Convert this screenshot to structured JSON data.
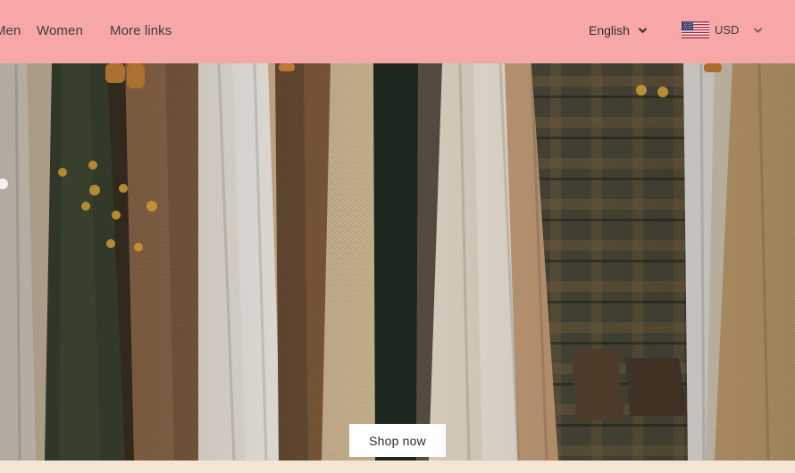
{
  "header": {
    "background": "#f7a7a7",
    "nav": [
      {
        "label": "Men"
      },
      {
        "label": "Women"
      },
      {
        "label": "More links"
      }
    ],
    "language": {
      "selected": "English",
      "icon": "chevron-down-icon"
    },
    "currency": {
      "selected": "USD",
      "flag": "us-flag-icon",
      "icon": "chevron-down-icon"
    }
  },
  "hero": {
    "image": "hanging-clothes-rack",
    "cta_label": "Shop now"
  }
}
